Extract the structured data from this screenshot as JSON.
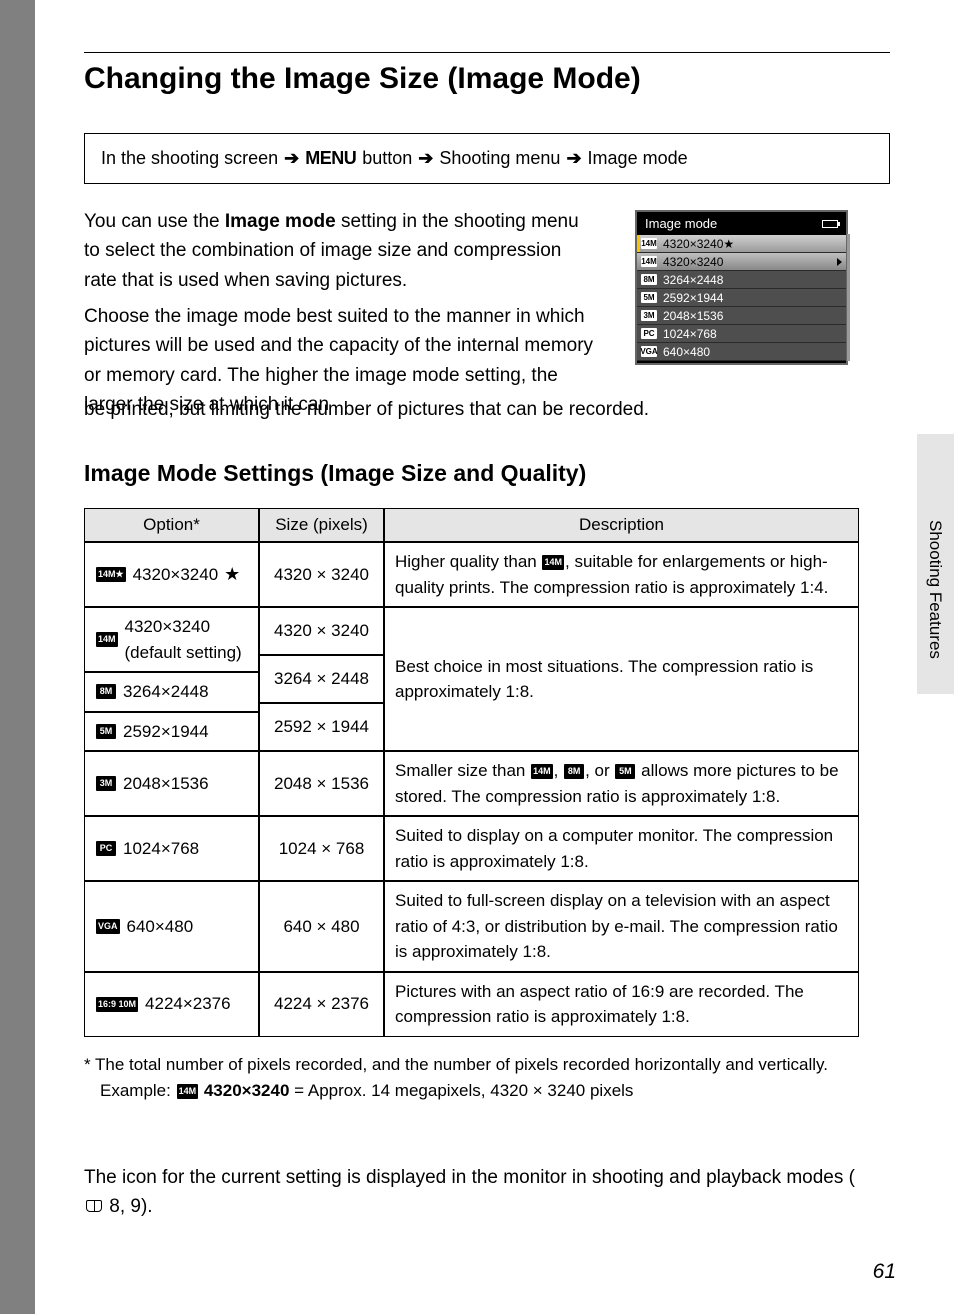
{
  "title": "Changing the Image Size (Image Mode)",
  "breadcrumb": {
    "step1": "In the shooting screen",
    "step2_icon": "MENU",
    "step2_suffix": "button",
    "step3": "Shooting menu",
    "step4": "Image mode"
  },
  "para1_a": "You can use the ",
  "para1_b": "Image mode",
  "para1_c": " setting in the shooting menu to select the combination of image size and compression rate that is used when saving pictures.",
  "para2": "Choose the image mode best suited to the manner in which pictures will be used and the capacity of the internal memory or memory card. The higher the image mode setting, the larger the size at which it can",
  "para2b": "be printed, but limiting the number of pictures that can be recorded.",
  "lcd": {
    "title": "Image mode",
    "rows": [
      {
        "icon": "14M",
        "label": "4320×3240★",
        "sel": true
      },
      {
        "icon": "14M",
        "label": "4320×3240",
        "hilite": true
      },
      {
        "icon": "8M",
        "label": "3264×2448"
      },
      {
        "icon": "5M",
        "label": "2592×1944"
      },
      {
        "icon": "3M",
        "label": "2048×1536"
      },
      {
        "icon": "PC",
        "label": "1024×768"
      },
      {
        "icon": "VGA",
        "label": "640×480"
      }
    ]
  },
  "subheading": "Image Mode Settings (Image Size and Quality)",
  "table": {
    "headers": [
      "Option*",
      "Size (pixels)",
      "Description"
    ],
    "rows": [
      {
        "icon": "14M★",
        "option": "4320×3240",
        "option_suffix": "★",
        "size": "4320 × 3240",
        "desc_a": "Higher quality than ",
        "desc_icon": "14M",
        "desc_b": ", suitable for enlargements or high-quality prints. The compression ratio is approximately 1:4."
      },
      {
        "icon": "14M",
        "option": "4320×3240",
        "option_sub": "(default setting)",
        "size": "4320 × 3240",
        "desc_shared": "Best choice in most situations. The compression ratio is approximately 1:8.",
        "span_start": true
      },
      {
        "icon": "8M",
        "option": "3264×2448",
        "size": "3264 × 2448",
        "span_mid": true
      },
      {
        "icon": "5M",
        "option": "2592×1944",
        "size": "2592 × 1944",
        "span_end": true
      },
      {
        "icon": "3M",
        "option": "2048×1536",
        "size": "2048 × 1536",
        "desc_a": "Smaller size than ",
        "desc_icons": [
          "14M",
          "8M",
          "5M"
        ],
        "desc_b": " allows more pictures to be stored. The compression ratio is approximately 1:8."
      },
      {
        "icon": "PC",
        "option": "1024×768",
        "size": "1024 × 768",
        "desc": "Suited to display on a computer monitor. The compression ratio is approximately 1:8."
      },
      {
        "icon": "VGA",
        "option": "640×480",
        "size": "640 × 480",
        "desc": "Suited to full-screen display on a television with an aspect ratio of 4:3, or distribution by e-mail. The compression ratio is approximately 1:8."
      },
      {
        "icon": "16:9 10M",
        "option": "4224×2376",
        "size": "4224 × 2376",
        "desc": "Pictures with an aspect ratio of 16:9 are recorded. The compression ratio is approximately 1:8."
      }
    ]
  },
  "footnote": {
    "line1": "*  The total number of pixels recorded, and the number of pixels recorded horizontally and vertically.",
    "line2_a": "Example: ",
    "line2_icon": "14M",
    "line2_b": "4320×3240",
    "line2_c": " = Approx. 14 megapixels, 4320 × 3240 pixels"
  },
  "closing_a": "The icon for the current setting is displayed in the monitor in shooting and playback modes (",
  "closing_b": " 8, 9).",
  "side_label": "Shooting Features",
  "page_number": "61"
}
